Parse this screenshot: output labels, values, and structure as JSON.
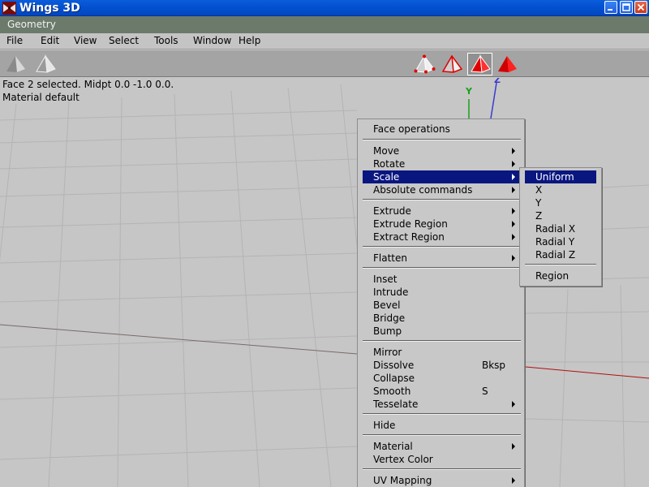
{
  "window": {
    "title": "Wings 3D"
  },
  "mode_label": "Geometry",
  "menubar": [
    "File",
    "Edit",
    "View",
    "Select",
    "Tools",
    "Window",
    "Help"
  ],
  "status": {
    "line1": "Face 2 selected. Midpt 0.0 -1.0 0.0.",
    "line2": "Material default"
  },
  "axes": {
    "y": "Y",
    "z": "Z"
  },
  "context_menu": {
    "header": "Face operations",
    "items": [
      {
        "label": "Move",
        "submenu": true
      },
      {
        "label": "Rotate",
        "submenu": true
      },
      {
        "label": "Scale",
        "submenu": true,
        "highlighted": true
      },
      {
        "label": "Absolute commands",
        "submenu": true
      },
      {
        "label": "Extrude",
        "submenu": true
      },
      {
        "label": "Extrude Region",
        "submenu": true
      },
      {
        "label": "Extract Region",
        "submenu": true
      },
      {
        "label": "Flatten",
        "submenu": true
      },
      {
        "label": "Inset"
      },
      {
        "label": "Intrude"
      },
      {
        "label": "Bevel"
      },
      {
        "label": "Bridge"
      },
      {
        "label": "Bump"
      },
      {
        "label": "Mirror"
      },
      {
        "label": "Dissolve",
        "hotkey": "Bksp"
      },
      {
        "label": "Collapse"
      },
      {
        "label": "Smooth",
        "hotkey": "S"
      },
      {
        "label": "Tesselate",
        "submenu": true
      },
      {
        "label": "Hide"
      },
      {
        "label": "Material",
        "submenu": true
      },
      {
        "label": "Vertex Color"
      },
      {
        "label": "UV Mapping",
        "submenu": true
      }
    ]
  },
  "scale_submenu": {
    "items": [
      {
        "label": "Uniform",
        "highlighted": true
      },
      {
        "label": "X"
      },
      {
        "label": "Y"
      },
      {
        "label": "Z"
      },
      {
        "label": "Radial X"
      },
      {
        "label": "Radial Y"
      },
      {
        "label": "Radial Z"
      },
      {
        "label": "Region"
      }
    ]
  },
  "colors": {
    "title_blue": "#0350cf",
    "menu_highlight": "#0a1680",
    "face_red": "#e00000",
    "axis_y": "#19a019",
    "axis_z": "#3a3ad0",
    "axis_x": "#b01010"
  },
  "icons": {
    "toolbar_left": [
      "smooth-shaded-icon",
      "wireframe-icon"
    ],
    "selection_modes": [
      "vertex-mode-icon",
      "edge-mode-icon",
      "face-mode-icon",
      "body-mode-icon"
    ]
  }
}
